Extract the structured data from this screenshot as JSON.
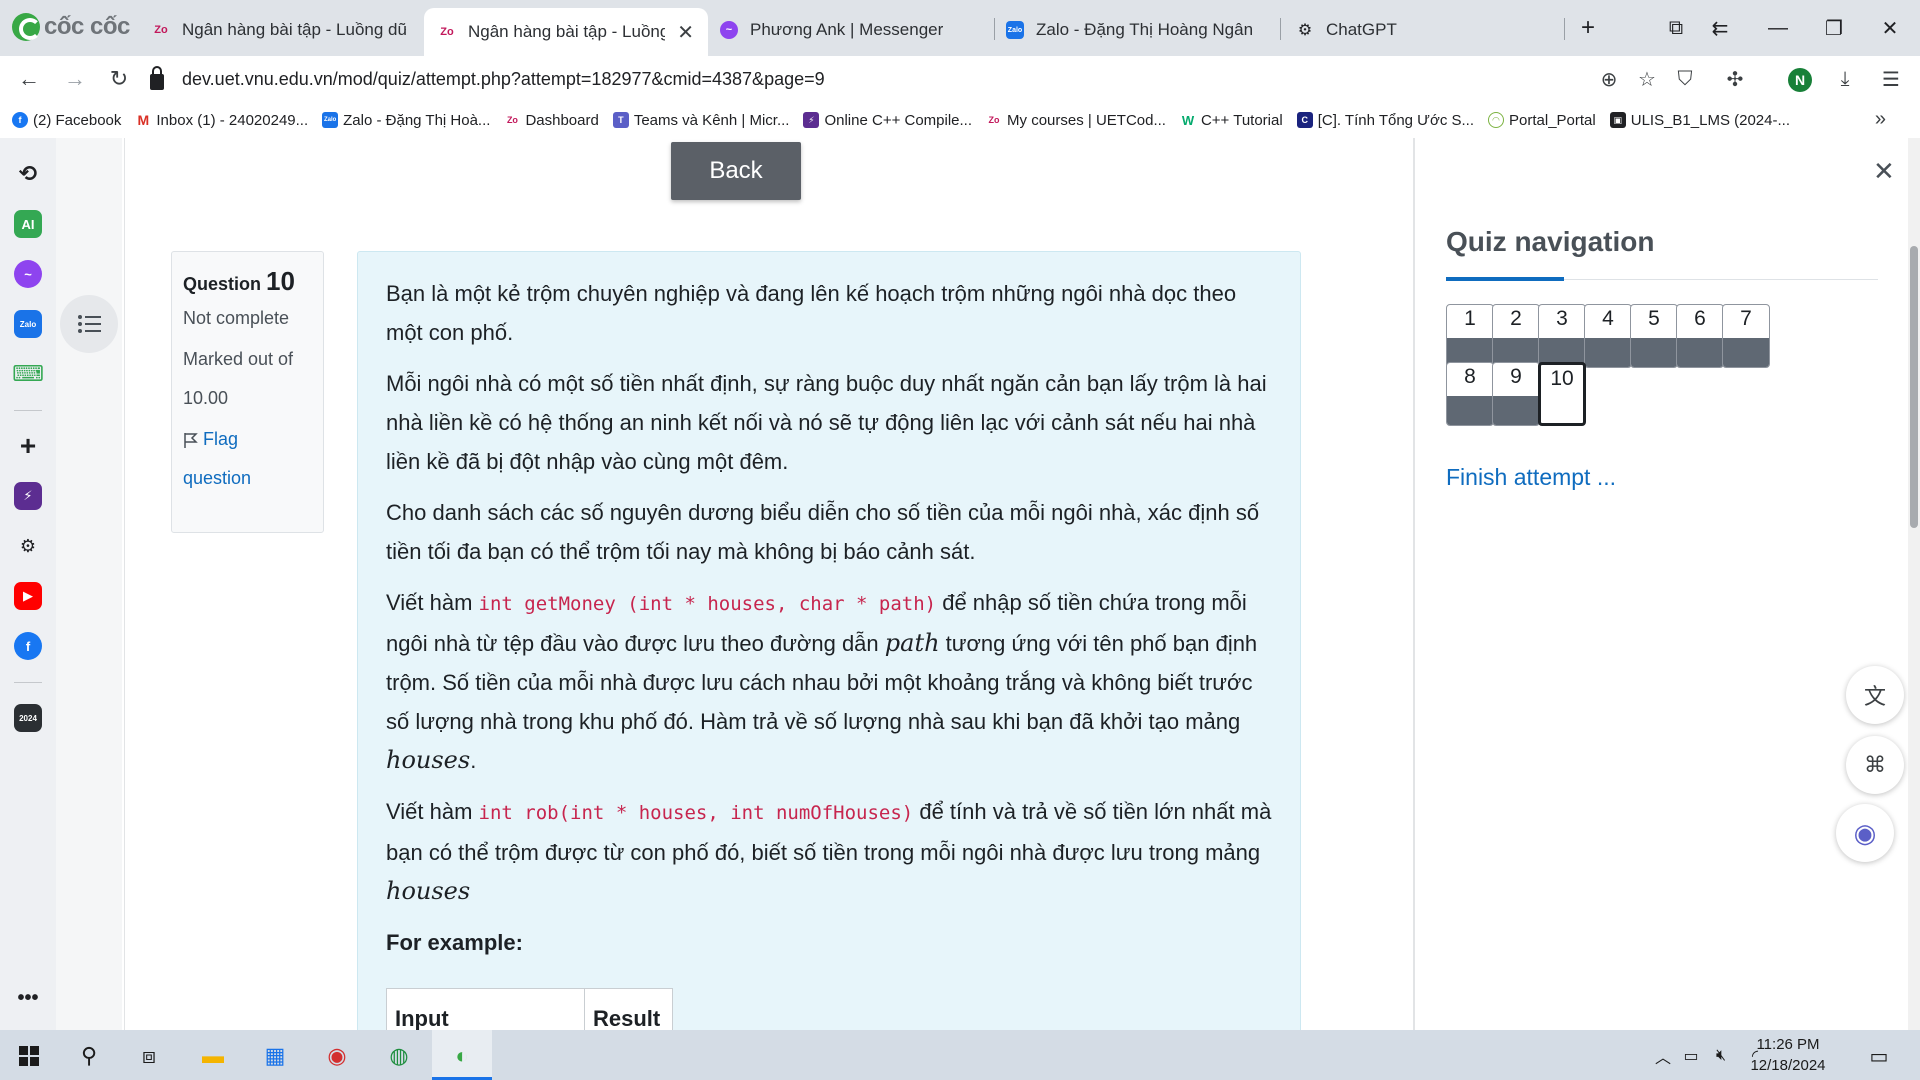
{
  "browser": {
    "brand": "cốc cốc",
    "tabs": [
      {
        "title": "Ngân hàng bài tập - Luồng dữ li",
        "active": false
      },
      {
        "title": "Ngân hàng bài tập - Luồng",
        "active": true
      },
      {
        "title": "Phương Ank | Messenger",
        "active": false
      },
      {
        "title": "Zalo - Đặng Thị Hoàng Ngân",
        "active": false
      },
      {
        "title": "ChatGPT",
        "active": false
      }
    ],
    "url": "dev.uet.vnu.edu.vn/mod/quiz/attempt.php?attempt=182977&cmid=4387&page=9",
    "profile_initial": "N",
    "bookmarks": [
      "(2) Facebook",
      "Inbox (1) - 24020249...",
      "Zalo - Đặng Thị Hoà...",
      "Dashboard",
      "Teams và Kênh | Micr...",
      "Online C++ Compile...",
      "My courses | UETCod...",
      "C++ Tutorial",
      "[C]. Tính Tổng Ước S...",
      "Portal_Portal",
      "ULIS_B1_LMS (2024-..."
    ]
  },
  "page": {
    "back_label": "Back",
    "question_info": {
      "label": "Question",
      "number": "10",
      "status": "Not complete",
      "marked_label": "Marked out of",
      "marked_value": "10.00",
      "flag_label": "Flag",
      "flag_label2": "question"
    },
    "question_text": {
      "p1": "Bạn là một kẻ trộm chuyên nghiệp và đang lên kế hoạch trộm những ngôi nhà dọc theo một con phố.",
      "p2": "Mỗi ngôi nhà có một số tiền nhất định, sự ràng buộc duy nhất ngăn cản bạn lấy trộm là hai nhà liền kề có hệ thống an ninh kết nối và nó sẽ tự động liên lạc với cảnh sát nếu hai nhà liền kề đã bị đột nhập vào cùng một đêm.",
      "p3": "Cho danh sách các số nguyên dương biểu diễn cho số tiền của mỗi ngôi nhà, xác định số tiền tối đa bạn có thể trộm tối nay mà không bị báo cảnh sát.",
      "p4_a": "Viết hàm ",
      "p4_code": "int getMoney (int * houses, char * path)",
      "p4_b": " để nhập số tiền chứa trong mỗi ngôi nhà từ tệp đầu vào được lưu theo đường dẫn ",
      "p4_math1": "path",
      "p4_c": " tương ứng với tên phố bạn định trộm. Số tiền của mỗi nhà được lưu cách nhau bởi một khoảng trắng và không biết trước số lượng nhà trong khu phố đó. Hàm trả về số lượng nhà sau khi bạn đã khởi tạo mảng ",
      "p4_math2": "houses",
      "p4_d": ".",
      "p5_a": "Viết hàm ",
      "p5_code": "int rob(int * houses, int numOfHouses)",
      "p5_b": " để tính và trả về số tiền lớn nhất mà bạn có thể trộm được từ con phố đó, biết số tiền trong mỗi ngôi nhà được lưu trong mảng ",
      "p5_math": "houses",
      "example_title": "For example:",
      "table_headers": [
        "Input",
        "Result"
      ]
    },
    "quiz_nav": {
      "title": "Quiz navigation",
      "buttons": [
        "1",
        "2",
        "3",
        "4",
        "5",
        "6",
        "7",
        "8",
        "9",
        "10"
      ],
      "current": "10",
      "finish_label": "Finish attempt ..."
    }
  },
  "taskbar": {
    "time": "11:26 PM",
    "date": "12/18/2024"
  },
  "colors": {
    "accent": "#0f6cbf",
    "question_bg": "#e7f5fa",
    "answered_state": "#5f6873",
    "code": "#c7254e"
  }
}
